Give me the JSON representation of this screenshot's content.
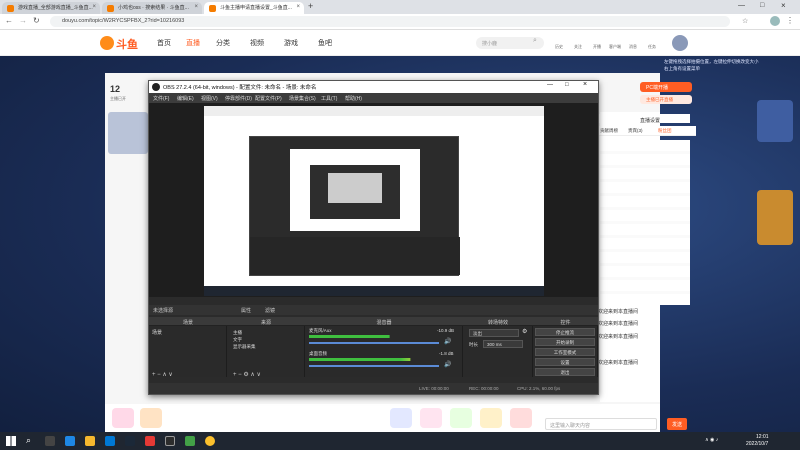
{
  "browser": {
    "tabs": [
      {
        "title": "游戏直播_全部游戏直播_斗鱼直..."
      },
      {
        "title": "小鸡也oss · 搜索结果 · 斗鱼直..."
      },
      {
        "title": "斗鱼主播申请直播设置_斗鱼直..."
      }
    ],
    "new_tab": "+",
    "url": "douyu.com/topic/W2RYCSPFBX_2?rid=10216093"
  },
  "douyu": {
    "logo": "斗鱼",
    "nav": [
      "首页",
      "直播",
      "分类",
      "视频",
      "游戏",
      "鱼吧"
    ],
    "search_placeholder": "搜小鹿",
    "top_icons": [
      "历史",
      "关注",
      "开播",
      "客户端",
      "消息",
      "任务"
    ],
    "room_number": "12",
    "room_sub": "主播已开",
    "right_notice": [
      "左键拖拽选择拍摄位置，左键拉伸切换改变大小",
      "右上角有设置菜单"
    ],
    "pc_button": "PC端开播",
    "feature_button": "主播已开直播",
    "rank_tabs": [
      "贡献周榜",
      "贵宾(3)",
      "粉丝团"
    ],
    "broadcast_icon_label": "直播设置",
    "chat_messages": [
      "欢迎来到本直播间",
      "欢迎来到本直播间",
      "欢迎来到本直播间",
      "欢迎来到本直播间"
    ],
    "chat_input_placeholder": "这里输入聊天内容",
    "send_button": "发送"
  },
  "obs": {
    "title": "OBS 27.2.4 (64-bit, windows) - 配置文件: 未命名 - 场景: 未命名",
    "menu": [
      "文件(F)",
      "编辑(E)",
      "视图(V)",
      "停靠部件(D)",
      "配置文件(P)",
      "场景集合(S)",
      "工具(T)",
      "帮助(H)"
    ],
    "source_bar": {
      "name": "未选择源",
      "props": "属性",
      "filter": "滤镜"
    },
    "docks": [
      "场景",
      "来源",
      "混音器",
      "转场特效",
      "控件"
    ],
    "scenes": [
      "场景"
    ],
    "sources": [
      "主播",
      "文字",
      "显示器采集"
    ],
    "mixer": [
      {
        "name": "麦克风/Aux",
        "db": "-10.9 dB",
        "level": 0.62
      },
      {
        "name": "桌面音频",
        "db": "-1.8 dB",
        "level": 0.78
      }
    ],
    "transition": {
      "type": "淡出",
      "duration_label": "时长",
      "duration": "300 ms"
    },
    "controls": [
      "停止推流",
      "开始录制",
      "工作室模式",
      "设置",
      "退出"
    ],
    "status": {
      "live": "LIVE: 00:00:00",
      "rec": "REC: 00:00:00",
      "cpu": "CPU: 2.1%, 60.00 fps"
    }
  },
  "taskbar": {
    "time": "12:01",
    "date": "2022/10/7"
  },
  "colors": {
    "accent": "#ff5d23",
    "obs_bg": "#2b2b2b",
    "taskbar": "#1f2631"
  }
}
